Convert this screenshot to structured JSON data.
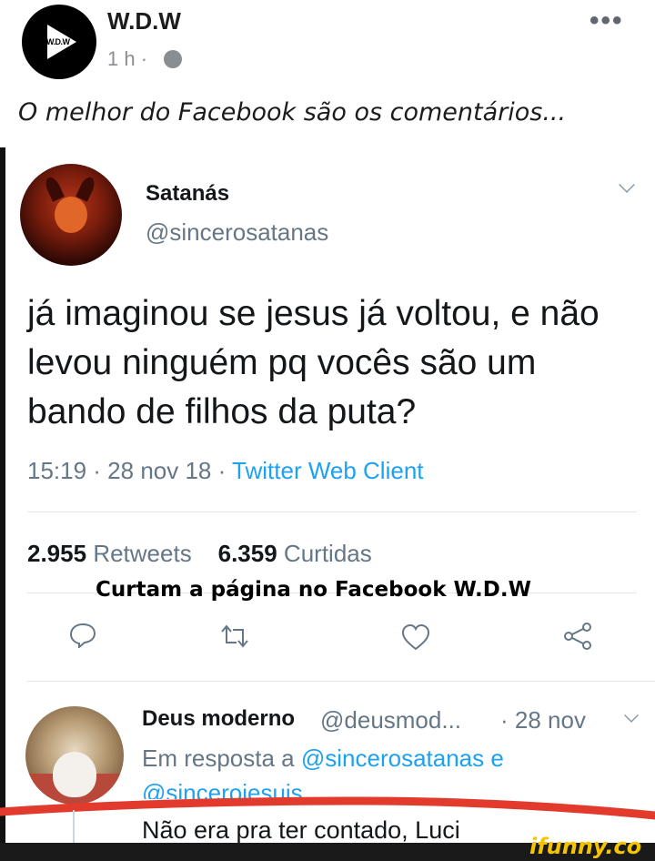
{
  "post": {
    "page_name": "W.D.W",
    "avatar_text": "W.D.W",
    "time": "1 h ·",
    "more": "•••",
    "caption": "O melhor do Facebook são os comentários..."
  },
  "tweet": {
    "name": "Satanás",
    "handle": "@sincerosatanas",
    "text": "já imaginou se jesus já voltou, e não levou ninguém pq vocês são um bando de filhos da puta?",
    "time": "15:19 · 28 nov 18 ·",
    "client": "Twitter Web Client",
    "retweets_count": "2.955",
    "retweets_label": "Retweets",
    "likes_count": "6.359",
    "likes_label": "Curtidas"
  },
  "watermark": "Curtam a página no Facebook W.D.W",
  "reply": {
    "name": "Deus moderno",
    "handle": "@deusmod...",
    "date": "· 28 nov",
    "in_reply_prefix": "Em resposta a",
    "mention1": "@sincerosatanas e",
    "mention2": "@sinceroiesuis",
    "text": "Não era pra ter contado, Luci"
  },
  "ifunny_logo": "ifunny.co",
  "colors": {
    "link_blue": "#1da1f2",
    "muted_gray": "#657786",
    "red_scribble": "#e23b2e",
    "ifunny_yellow": "#f5c400"
  },
  "icons": [
    "play-icon",
    "globe-icon",
    "chevron-down-icon",
    "reply-icon",
    "retweet-icon",
    "like-icon",
    "share-icon"
  ]
}
